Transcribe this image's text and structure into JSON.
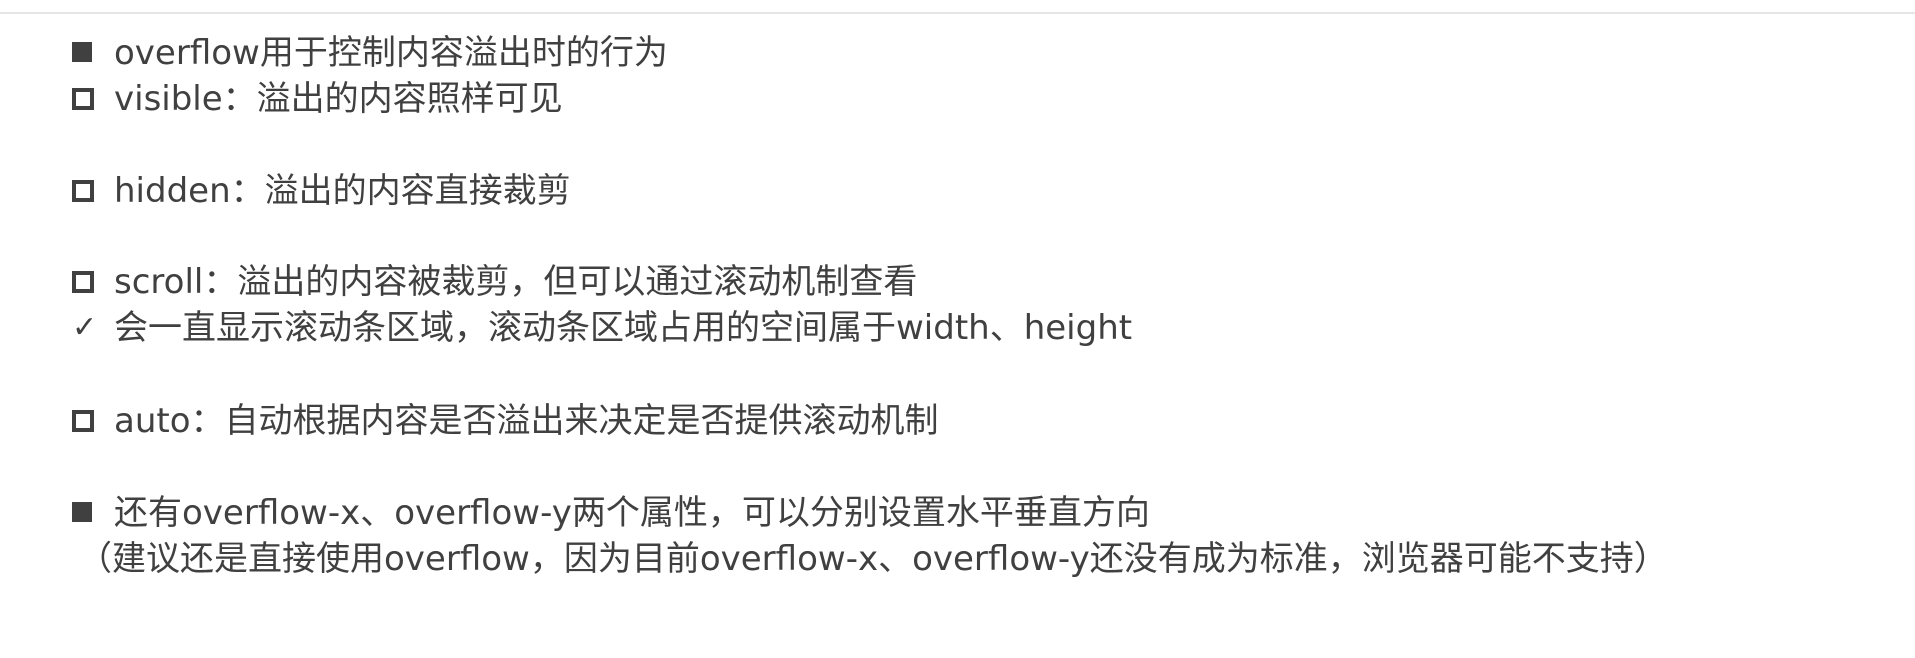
{
  "slide": {
    "lines": [
      {
        "marker": "filled-square",
        "text": "overflow用于控制内容溢出时的行为"
      },
      {
        "marker": "hollow-square",
        "text": "visible：溢出的内容照样可见"
      },
      {
        "marker": "hollow-square",
        "text": "hidden：溢出的内容直接裁剪"
      },
      {
        "marker": "hollow-square",
        "text": "scroll：溢出的内容被裁剪，但可以通过滚动机制查看"
      },
      {
        "marker": "check",
        "text": "会一直显示滚动条区域，滚动条区域占用的空间属于width、height"
      },
      {
        "marker": "hollow-square",
        "text": "auto：自动根据内容是否溢出来决定是否提供滚动机制"
      },
      {
        "marker": "filled-square",
        "text": "还有overflow-x、overflow-y两个属性，可以分别设置水平垂直方向"
      }
    ],
    "note": "（建议还是直接使用overflow，因为目前overflow-x、overflow-y还没有成为标准，浏览器可能不支持）",
    "check_glyph": "✓"
  }
}
